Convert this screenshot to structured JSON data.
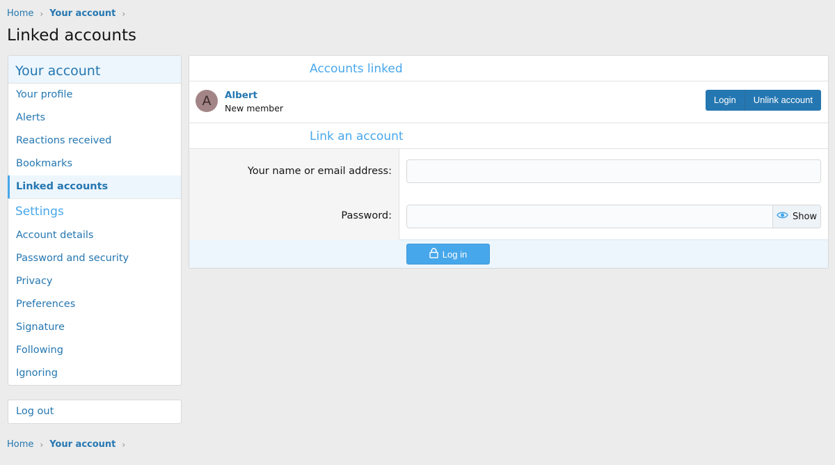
{
  "breadcrumb": {
    "home": "Home",
    "account": "Your account"
  },
  "page": {
    "title": "Linked accounts"
  },
  "sidebar": {
    "heading": "Your account",
    "items": [
      {
        "label": "Your profile"
      },
      {
        "label": "Alerts"
      },
      {
        "label": "Reactions received"
      },
      {
        "label": "Bookmarks"
      },
      {
        "label": "Linked accounts"
      }
    ],
    "settings_heading": "Settings",
    "settings_items": [
      {
        "label": "Account details"
      },
      {
        "label": "Password and security"
      },
      {
        "label": "Privacy"
      },
      {
        "label": "Preferences"
      },
      {
        "label": "Signature"
      },
      {
        "label": "Following"
      },
      {
        "label": "Ignoring"
      }
    ],
    "logout": "Log out"
  },
  "linked": {
    "heading": "Accounts linked",
    "account": {
      "avatar_letter": "A",
      "name": "Albert",
      "role": "New member"
    },
    "login_button": "Login",
    "unlink_button": "Unlink account"
  },
  "link_form": {
    "heading": "Link an account",
    "username_label": "Your name or email address:",
    "username_value": "",
    "password_label": "Password:",
    "password_value": "",
    "show_label": "Show",
    "submit_label": "Log in"
  },
  "colors": {
    "accent": "#2577b1",
    "accent_light": "#47a7eb",
    "avatar_bg": "#a38587",
    "page_bg": "#ececec"
  },
  "icons": {
    "show": "eye-icon",
    "submit": "lock-icon",
    "breadcrumb_sep": "chevron-right-icon"
  }
}
